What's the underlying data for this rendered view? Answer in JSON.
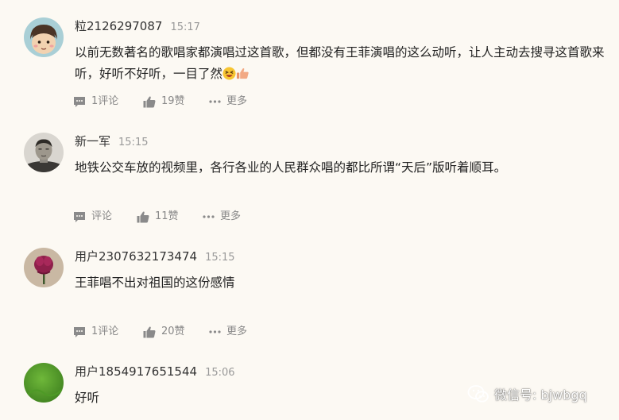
{
  "comments": [
    {
      "username": "粒2126297087",
      "time": "15:17",
      "text": "以前无数著名的歌唱家都演唱过这首歌，但都没有王菲演唱的这么动听，让人主动去搜寻这首歌来听，好听不好听，一目了然",
      "emojis": [
        "laughing-face-emoji",
        "thumbs-up-emoji"
      ],
      "reply_label": "1评论",
      "like_label": "19赞",
      "more_label": "更多"
    },
    {
      "username": "新一军",
      "time": "15:15",
      "text": "地铁公交车放的视频里，各行各业的人民群众唱的都比所谓“天后”版听着顺耳。",
      "reply_label": "评论",
      "like_label": "11赞",
      "more_label": "更多"
    },
    {
      "username": "用户2307632173474",
      "time": "15:15",
      "text": "王菲唱不出对祖国的这份感情",
      "reply_label": "1评论",
      "like_label": "20赞",
      "more_label": "更多"
    },
    {
      "username": "用户1854917651544",
      "time": "15:06",
      "text": "好听"
    }
  ],
  "watermark": {
    "icon": "wechat-icon",
    "text": "微信号: bjwbgq"
  },
  "colors": {
    "background": "#fcf9f3",
    "text": "#222222",
    "meta": "#999999",
    "action": "#888888"
  }
}
